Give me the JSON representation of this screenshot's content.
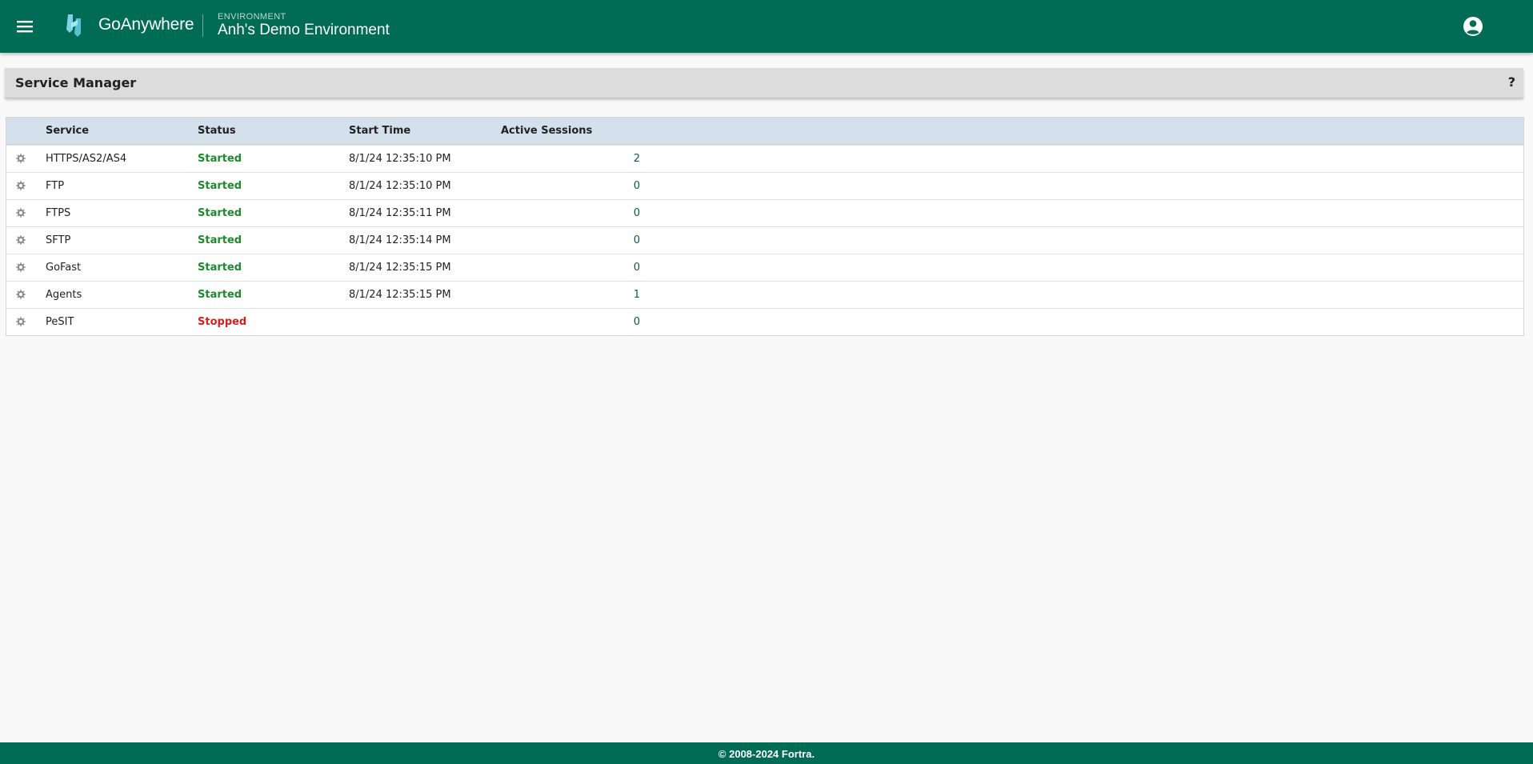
{
  "header": {
    "app_name": "GoAnywhere",
    "env_label": "ENVIRONMENT",
    "env_name": "Anh's Demo Environment"
  },
  "panel": {
    "title": "Service Manager",
    "help": "?"
  },
  "table": {
    "columns": [
      "Service",
      "Status",
      "Start Time",
      "Active Sessions"
    ],
    "rows": [
      {
        "service": "HTTPS/AS2/AS4",
        "status": "Started",
        "start_time": "8/1/24 12:35:10 PM",
        "sessions": "2"
      },
      {
        "service": "FTP",
        "status": "Started",
        "start_time": "8/1/24 12:35:10 PM",
        "sessions": "0"
      },
      {
        "service": "FTPS",
        "status": "Started",
        "start_time": "8/1/24 12:35:11 PM",
        "sessions": "0"
      },
      {
        "service": "SFTP",
        "status": "Started",
        "start_time": "8/1/24 12:35:14 PM",
        "sessions": "0"
      },
      {
        "service": "GoFast",
        "status": "Started",
        "start_time": "8/1/24 12:35:15 PM",
        "sessions": "0"
      },
      {
        "service": "Agents",
        "status": "Started",
        "start_time": "8/1/24 12:35:15 PM",
        "sessions": "1"
      },
      {
        "service": "PeSIT",
        "status": "Stopped",
        "start_time": "",
        "sessions": "0"
      }
    ]
  },
  "footer": {
    "copyright": "© 2008-2024 Fortra."
  },
  "colors": {
    "brand": "#006c56",
    "started": "#1d8a2e",
    "stopped": "#d32121",
    "table_header": "#d4e0ec"
  },
  "icons": [
    "menu-icon",
    "goanywhere-logo",
    "user-account-icon",
    "gear-icon",
    "help-icon"
  ]
}
